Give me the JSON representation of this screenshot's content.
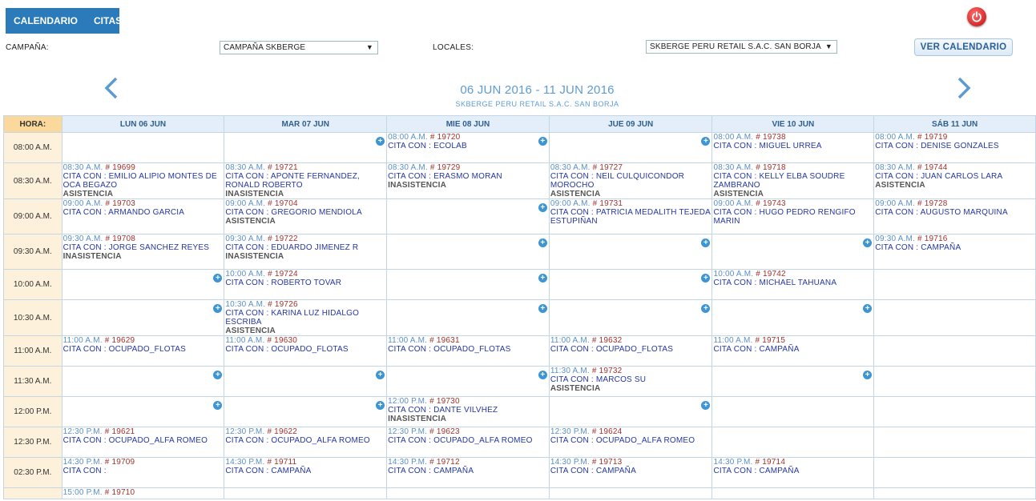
{
  "nav": {
    "tabs": [
      "CALENDARIO",
      "CITAS"
    ]
  },
  "filters": {
    "campaign_label": "CAMPAÑA:",
    "campaign_value": "CAMPAÑA SKBERGE",
    "locales_label": "LOCALES:",
    "locales_value": "SKBERGE PERU RETAIL S.A.C. SAN BORJA",
    "ver_calendario": "VER CALENDARIO"
  },
  "header": {
    "range": "06 JUN 2016 - 11 JUN 2016",
    "store": "SKBERGE PERU RETAIL S.A.C. SAN BORJA"
  },
  "grid": {
    "hora_label": "HORA:",
    "days": [
      "LUN 06 JUN",
      "MAR 07 JUN",
      "MIE 08 JUN",
      "JUE 09 JUN",
      "VIE 10 JUN",
      "SÁB 11 JUN"
    ],
    "rows": [
      {
        "time": "08:00 A.M.",
        "cells": [
          {
            "add": false
          },
          {
            "add": true
          },
          {
            "t": "08:00 A.M.",
            "n": "# 19720",
            "who": "CITA CON : ECOLAB",
            "add": true
          },
          {
            "add": true
          },
          {
            "t": "08:00 A.M.",
            "n": "# 19738",
            "who": "CITA CON : MIGUEL URREA"
          },
          {
            "t": "08:00 A.M.",
            "n": "# 19719",
            "who": "CITA CON : DENISE GONZALES"
          }
        ]
      },
      {
        "time": "08:30 A.M.",
        "cells": [
          {
            "t": "08:30 A.M.",
            "n": "# 19699",
            "who": "CITA CON : EMILIO ALIPIO MONTES DE OCA BEGAZO",
            "st": "ASISTENCIA"
          },
          {
            "t": "08:30 A.M.",
            "n": "# 19721",
            "who": "CITA CON : APONTE FERNANDEZ, RONALD ROBERTO",
            "st": "INASISTENCIA"
          },
          {
            "t": "08:30 A.M.",
            "n": "# 19729",
            "who": "CITA CON : ERASMO MORAN",
            "st": "INASISTENCIA"
          },
          {
            "t": "08:30 A.M.",
            "n": "# 19727",
            "who": "CITA CON : NEIL CULQUICONDOR MOROCHO",
            "st": "ASISTENCIA"
          },
          {
            "t": "08:30 A.M.",
            "n": "# 19718",
            "who": "CITA CON : KELLY ELBA SOUDRE ZAMBRANO",
            "st": "ASISTENCIA"
          },
          {
            "t": "08:30 A.M.",
            "n": "# 19744",
            "who": "CITA CON : JUAN CARLOS LARA",
            "st": "ASISTENCIA"
          }
        ]
      },
      {
        "time": "09:00 A.M.",
        "cells": [
          {
            "t": "09:00 A.M.",
            "n": "# 19703",
            "who": "CITA CON : ARMANDO GARCIA"
          },
          {
            "t": "09:00 A.M.",
            "n": "# 19704",
            "who": "CITA CON : GREGORIO MENDIOLA",
            "st": "ASISTENCIA"
          },
          {
            "add": true
          },
          {
            "t": "09:00 A.M.",
            "n": "# 19731",
            "who": "CITA CON : PATRICIA MEDALITH TEJEDA ESTUPIÑAN"
          },
          {
            "t": "09:00 A.M.",
            "n": "# 19743",
            "who": "CITA CON : HUGO PEDRO RENGIFO MARIN"
          },
          {
            "t": "09:00 A.M.",
            "n": "# 19728",
            "who": "CITA CON : AUGUSTO MARQUINA"
          }
        ]
      },
      {
        "time": "09:30 A.M.",
        "cells": [
          {
            "t": "09:30 A.M.",
            "n": "# 19708",
            "who": "CITA CON : JORGE SANCHEZ REYES",
            "st": "INASISTENCIA"
          },
          {
            "t": "09:30 A.M.",
            "n": "# 19722",
            "who": "CITA CON : EDUARDO JIMENEZ R",
            "st": "INASISTENCIA"
          },
          {
            "add": true
          },
          {
            "add": true
          },
          {
            "add": true
          },
          {
            "t": "09:30 A.M.",
            "n": "# 19716",
            "who": "CITA CON : CAMPAÑA"
          }
        ]
      },
      {
        "time": "10:00 A.M.",
        "cells": [
          {
            "add": true
          },
          {
            "t": "10:00 A.M.",
            "n": "# 19724",
            "who": "CITA CON : ROBERTO TOVAR"
          },
          {
            "add": true
          },
          {
            "add": true
          },
          {
            "t": "10:00 A.M.",
            "n": "# 19742",
            "who": "CITA CON : MICHAEL TAHUANA"
          },
          {
            "add": false
          }
        ]
      },
      {
        "time": "10:30 A.M.",
        "cells": [
          {
            "add": true
          },
          {
            "t": "10:30 A.M.",
            "n": "# 19726",
            "who": "CITA CON : KARINA LUZ HIDALGO ESCRIBA",
            "st": "ASISTENCIA"
          },
          {
            "add": true
          },
          {
            "add": true
          },
          {
            "add": true
          },
          {
            "add": false
          }
        ]
      },
      {
        "time": "11:00 A.M.",
        "cells": [
          {
            "t": "11:00 A.M.",
            "n": "# 19629",
            "who": "CITA CON : OCUPADO_FLOTAS"
          },
          {
            "t": "11:00 A.M.",
            "n": "# 19630",
            "who": "CITA CON : OCUPADO_FLOTAS"
          },
          {
            "t": "11:00 A.M.",
            "n": "# 19631",
            "who": "CITA CON : OCUPADO_FLOTAS"
          },
          {
            "t": "11:00 A.M.",
            "n": "# 19632",
            "who": "CITA CON : OCUPADO_FLOTAS"
          },
          {
            "t": "11:00 A.M.",
            "n": "# 19715",
            "who": "CITA CON : CAMPAÑA"
          },
          {
            "add": false
          }
        ]
      },
      {
        "time": "11:30 A.M.",
        "cells": [
          {
            "add": true
          },
          {
            "add": true
          },
          {
            "add": true
          },
          {
            "t": "11:30 A.M.",
            "n": "# 19732",
            "who": "CITA CON : MARCOS SU",
            "st": "ASISTENCIA"
          },
          {
            "add": true
          },
          {
            "add": false
          }
        ]
      },
      {
        "time": "12:00 P.M.",
        "cells": [
          {
            "add": true
          },
          {
            "add": true
          },
          {
            "t": "12:00 P.M.",
            "n": "# 19730",
            "who": "CITA CON : DANTE VILVHEZ",
            "st": "INASISTENCIA"
          },
          {
            "add": true
          },
          {
            "add": false
          },
          {
            "add": false
          }
        ]
      },
      {
        "time": "12:30 P.M.",
        "cells": [
          {
            "t": "12:30 P.M.",
            "n": "# 19621",
            "who": "CITA CON : OCUPADO_ALFA ROMEO"
          },
          {
            "t": "12:30 P.M.",
            "n": "# 19622",
            "who": "CITA CON : OCUPADO_ALFA ROMEO"
          },
          {
            "t": "12:30 P.M.",
            "n": "# 19623",
            "who": "CITA CON : OCUPADO_ALFA ROMEO"
          },
          {
            "t": "12:30 P.M.",
            "n": "# 19624",
            "who": "CITA CON : OCUPADO_ALFA ROMEO"
          },
          {
            "add": false
          },
          {
            "add": false
          }
        ]
      },
      {
        "time": "02:30 P.M.",
        "cells": [
          {
            "t": "14:30 P.M.",
            "n": "# 19709",
            "who": "CITA CON :"
          },
          {
            "t": "14:30 P.M.",
            "n": "# 19711",
            "who": "CITA CON : CAMPAÑA"
          },
          {
            "t": "14:30 P.M.",
            "n": "# 19712",
            "who": "CITA CON : CAMPAÑA"
          },
          {
            "t": "14:30 P.M.",
            "n": "# 19713",
            "who": "CITA CON : CAMPAÑA"
          },
          {
            "t": "14:30 P.M.",
            "n": "# 19714",
            "who": "CITA CON : CAMPAÑA"
          },
          {
            "add": false
          }
        ]
      },
      {
        "time": "",
        "cells": [
          {
            "t": "15:00 P.M.",
            "n": "# 19710",
            "who": ""
          },
          {
            "add": false
          },
          {
            "add": false
          },
          {
            "add": false
          },
          {
            "add": false
          },
          {
            "add": false
          }
        ]
      }
    ]
  }
}
